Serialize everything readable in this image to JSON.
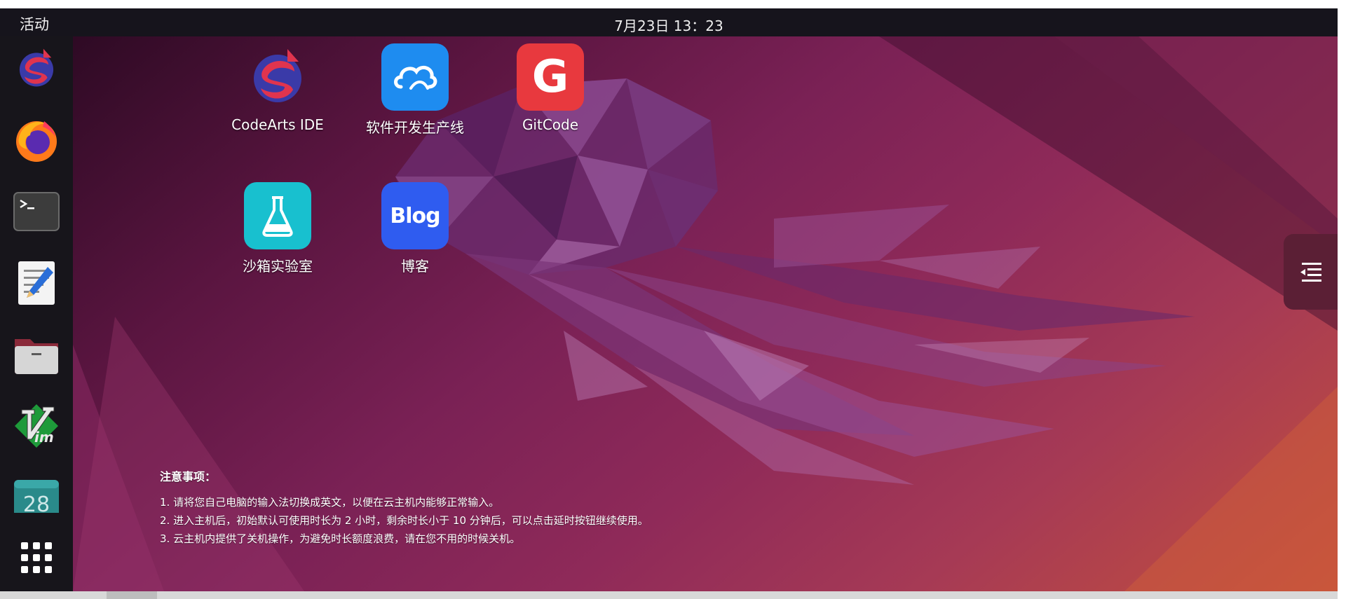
{
  "topbar": {
    "activities": "活动",
    "clock": "7月23日  13：23"
  },
  "dock": {
    "items": [
      {
        "name": "codearts-ide",
        "icon": "codearts-icon"
      },
      {
        "name": "firefox",
        "icon": "firefox-icon"
      },
      {
        "name": "terminal",
        "icon": "terminal-icon"
      },
      {
        "name": "text-editor",
        "icon": "text-editor-icon"
      },
      {
        "name": "files",
        "icon": "folder-icon"
      },
      {
        "name": "vim",
        "icon": "vim-icon",
        "text": "im"
      },
      {
        "name": "calendar",
        "icon": "calendar-icon",
        "text": "28"
      },
      {
        "name": "show-apps",
        "icon": "app-grid-icon"
      }
    ]
  },
  "desktop": {
    "icons": [
      {
        "label": "CodeArts IDE",
        "icon": "codearts-icon"
      },
      {
        "label": "软件开发生产线",
        "icon": "cloud-icon"
      },
      {
        "label": "GitCode",
        "icon": "gitcode-icon",
        "glyph": "G"
      },
      {
        "label": "沙箱实验室",
        "icon": "flask-icon"
      },
      {
        "label": "博客",
        "icon": "blog-icon",
        "glyph": "Blog"
      }
    ]
  },
  "notice": {
    "title": "注意事项：",
    "lines": [
      "1.  请将您自己电脑的输入法切换成英文，以便在云主机内能够正常输入。",
      "2.  进入主机后，初始默认可使用时长为 2 小时，剩余时长小于 10 分钟后，可以点击延时按钮继续使用。",
      "3.  云主机内提供了关机操作，为避免时长额度浪费，请在您不用的时候关机。"
    ]
  },
  "side_panel": {
    "icon": "menu-collapse-icon"
  },
  "colors": {
    "topbar_bg": "#16141c",
    "dock_bg": "#17151b",
    "wallpaper_dark": "#2e0a24",
    "wallpaper_mid": "#8f2a59",
    "wallpaper_warm": "#c4503c",
    "cloud_tile": "#1e8cf0",
    "gitcode_tile": "#e8393e",
    "flask_tile": "#18c0cf",
    "blog_tile": "#2f5cf0"
  }
}
